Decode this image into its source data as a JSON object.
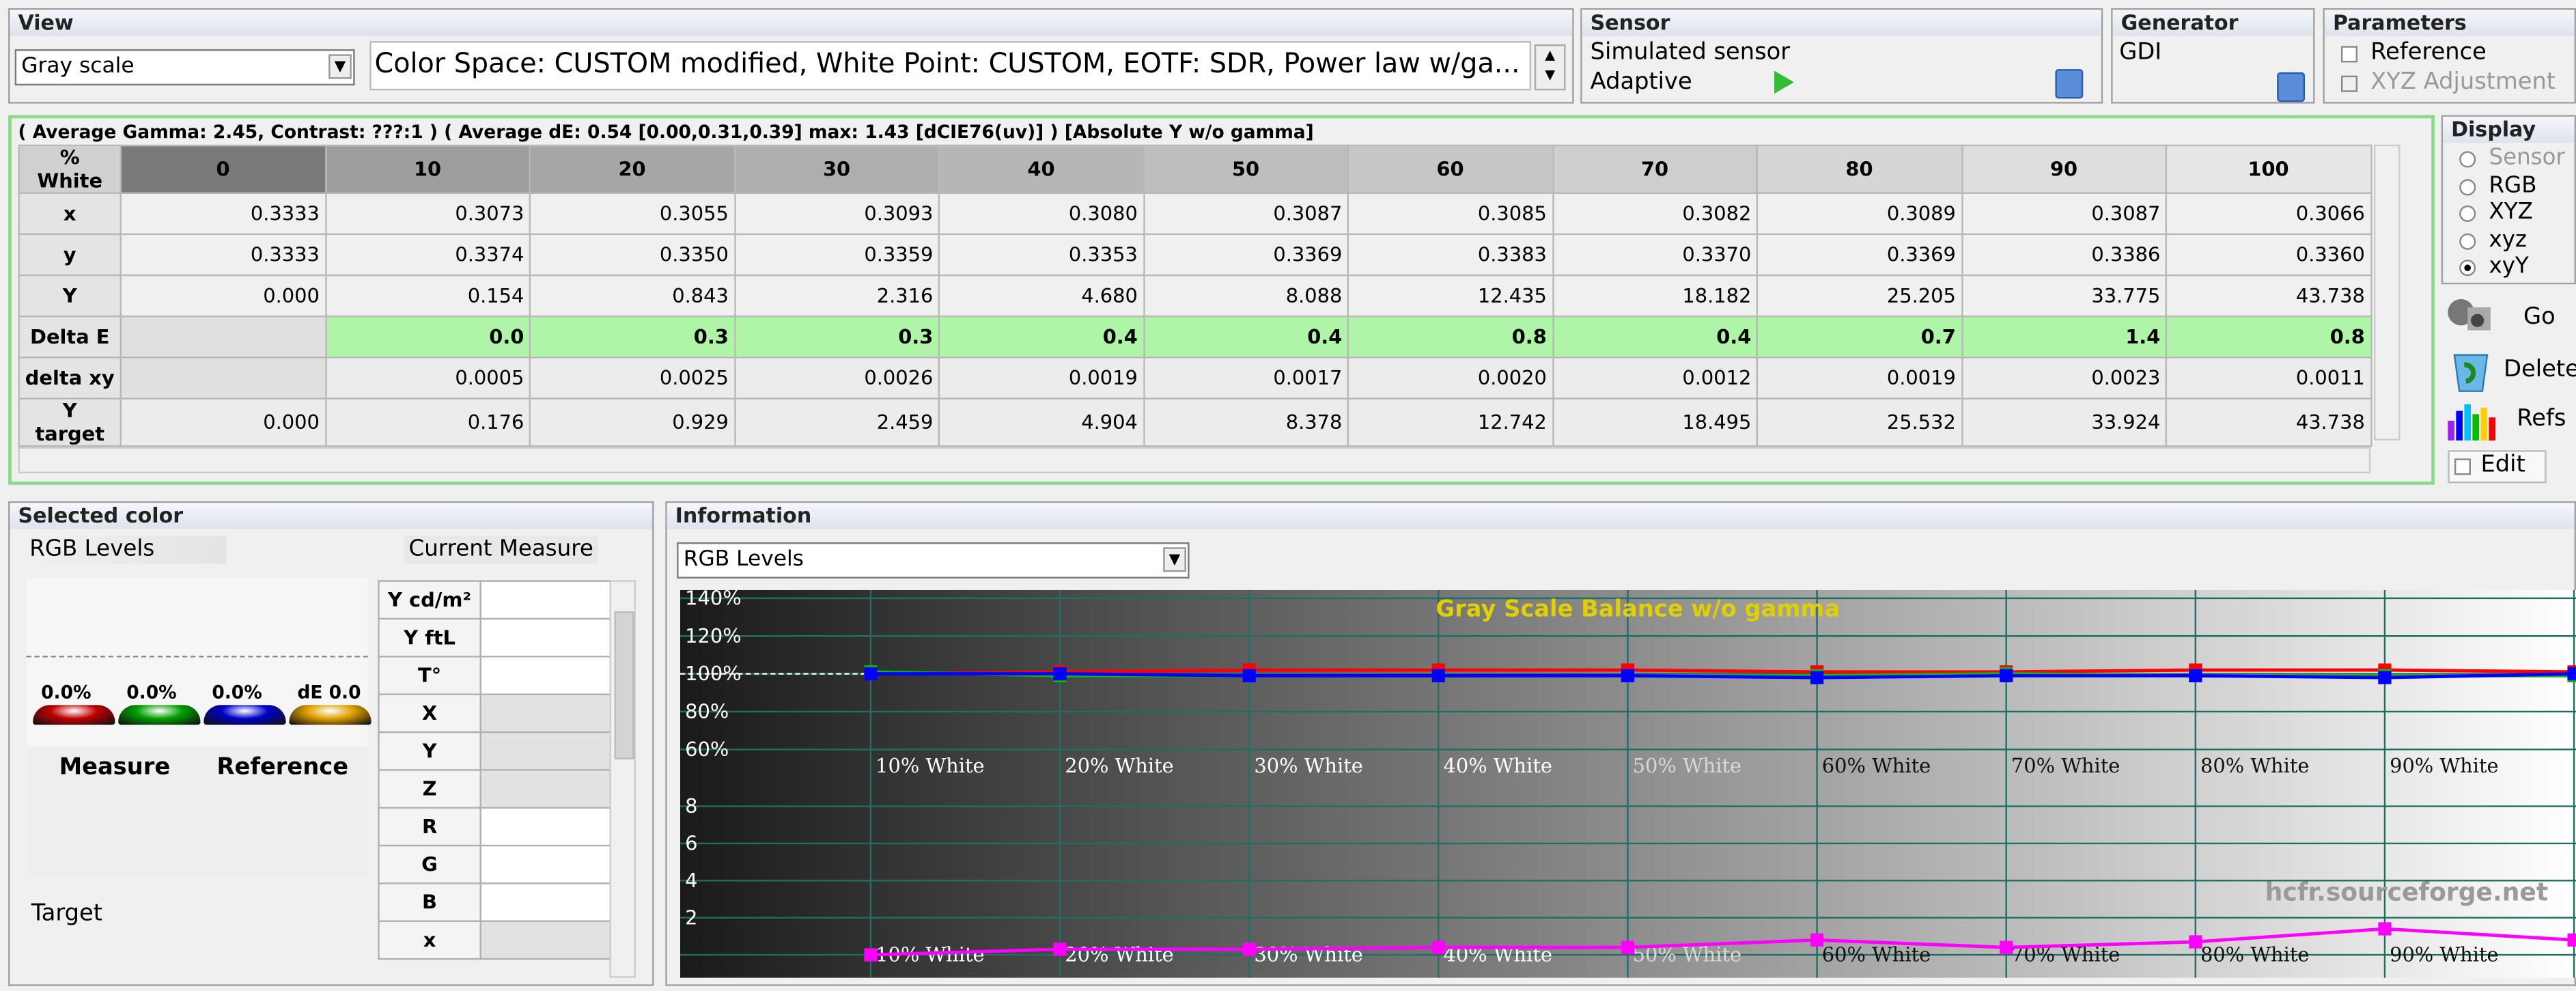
{
  "view": {
    "title": "View",
    "mode_selected": "Gray scale",
    "info_text": "Color Space: CUSTOM modified, White Point: CUSTOM, EOTF:  SDR, Power law w/ga..."
  },
  "sensor": {
    "title": "Sensor",
    "name": "Simulated sensor",
    "mode": "Adaptive"
  },
  "generator": {
    "title": "Generator",
    "name": "GDI"
  },
  "parameters": {
    "title": "Parameters",
    "reference_label": "Reference",
    "xyz_adjust_label": "XYZ Adjustment"
  },
  "summary_line": "( Average Gamma: 2.45, Contrast: ???:1 ) ( Average dE: 0.54 [0.00,0.31,0.39] max: 1.43 [dCIE76(uv)] ) [Absolute Y w/o gamma]",
  "table": {
    "header_label": "% White",
    "columns": [
      "0",
      "10",
      "20",
      "30",
      "40",
      "50",
      "60",
      "70",
      "80",
      "90",
      "100"
    ],
    "rows": [
      {
        "label": "x",
        "values": [
          "0.3333",
          "0.3073",
          "0.3055",
          "0.3093",
          "0.3080",
          "0.3087",
          "0.3085",
          "0.3082",
          "0.3089",
          "0.3087",
          "0.3066"
        ]
      },
      {
        "label": "y",
        "values": [
          "0.3333",
          "0.3374",
          "0.3350",
          "0.3359",
          "0.3353",
          "0.3369",
          "0.3383",
          "0.3370",
          "0.3369",
          "0.3386",
          "0.3360"
        ]
      },
      {
        "label": "Y",
        "values": [
          "0.000",
          "0.154",
          "0.843",
          "2.316",
          "4.680",
          "8.088",
          "12.435",
          "18.182",
          "25.205",
          "33.775",
          "43.738"
        ]
      },
      {
        "label": "Delta E",
        "values": [
          "",
          "0.0",
          "0.3",
          "0.3",
          "0.4",
          "0.4",
          "0.8",
          "0.4",
          "0.7",
          "1.4",
          "0.8"
        ]
      },
      {
        "label": "delta xy",
        "values": [
          "",
          "0.0005",
          "0.0025",
          "0.0026",
          "0.0019",
          "0.0017",
          "0.0020",
          "0.0012",
          "0.0019",
          "0.0023",
          "0.0011"
        ]
      },
      {
        "label": "Y target",
        "values": [
          "0.000",
          "0.176",
          "0.929",
          "2.459",
          "4.904",
          "8.378",
          "12.742",
          "18.495",
          "25.532",
          "33.924",
          "43.738"
        ]
      }
    ]
  },
  "display": {
    "title": "Display",
    "options": [
      "Sensor",
      "RGB",
      "XYZ",
      "xyz",
      "xyY"
    ],
    "selected": "xyY",
    "go_label": "Go",
    "delete_label": "Delete",
    "refs_label": "Refs",
    "edit_label": "Edit"
  },
  "selected_color": {
    "title": "Selected color",
    "rgb_levels_label": "RGB Levels",
    "current_measure_label": "Current Measure",
    "drops": [
      {
        "value": "0.0%",
        "color": "#c00000"
      },
      {
        "value": "0.0%",
        "color": "#00a000"
      },
      {
        "value": "0.0%",
        "color": "#0000c8"
      },
      {
        "value": "dE 0.0",
        "color": "#e0a000"
      }
    ],
    "measure_label": "Measure",
    "reference_label": "Reference",
    "target_label": "Target",
    "measure_rows": [
      "Y cd/m²",
      "Y ftL",
      "T°",
      "X",
      "Y",
      "Z",
      "R",
      "G",
      "B",
      "x"
    ]
  },
  "information": {
    "title": "Information",
    "dropdown": "RGB Levels",
    "watermark": "hcfr.sourceforge.net"
  },
  "chart_data": {
    "type": "line",
    "title": "Gray Scale Balance w/o gamma",
    "categories": [
      "10% White",
      "20% White",
      "30% White",
      "40% White",
      "50% White",
      "60% White",
      "70% White",
      "80% White",
      "90% White"
    ],
    "top_yticks": [
      "140%",
      "120%",
      "100%",
      "80%",
      "60%"
    ],
    "bottom_yticks": [
      "8",
      "6",
      "4",
      "2"
    ],
    "series": [
      {
        "color": "#ff0000",
        "values": [
          100,
          101,
          102,
          102,
          102,
          101,
          101,
          102,
          102,
          101
        ]
      },
      {
        "color": "#00c000",
        "values": [
          101,
          99,
          99,
          99,
          99,
          99,
          100,
          99,
          99,
          99
        ]
      },
      {
        "color": "#0000ff",
        "values": [
          100,
          100,
          99,
          99,
          99,
          98,
          99,
          99,
          98,
          100
        ]
      }
    ],
    "delta_e_series": {
      "color": "#ff00ff",
      "values": [
        0.0,
        0.0,
        0.3,
        0.3,
        0.4,
        0.4,
        0.8,
        0.4,
        0.7,
        1.4,
        0.8
      ]
    }
  }
}
